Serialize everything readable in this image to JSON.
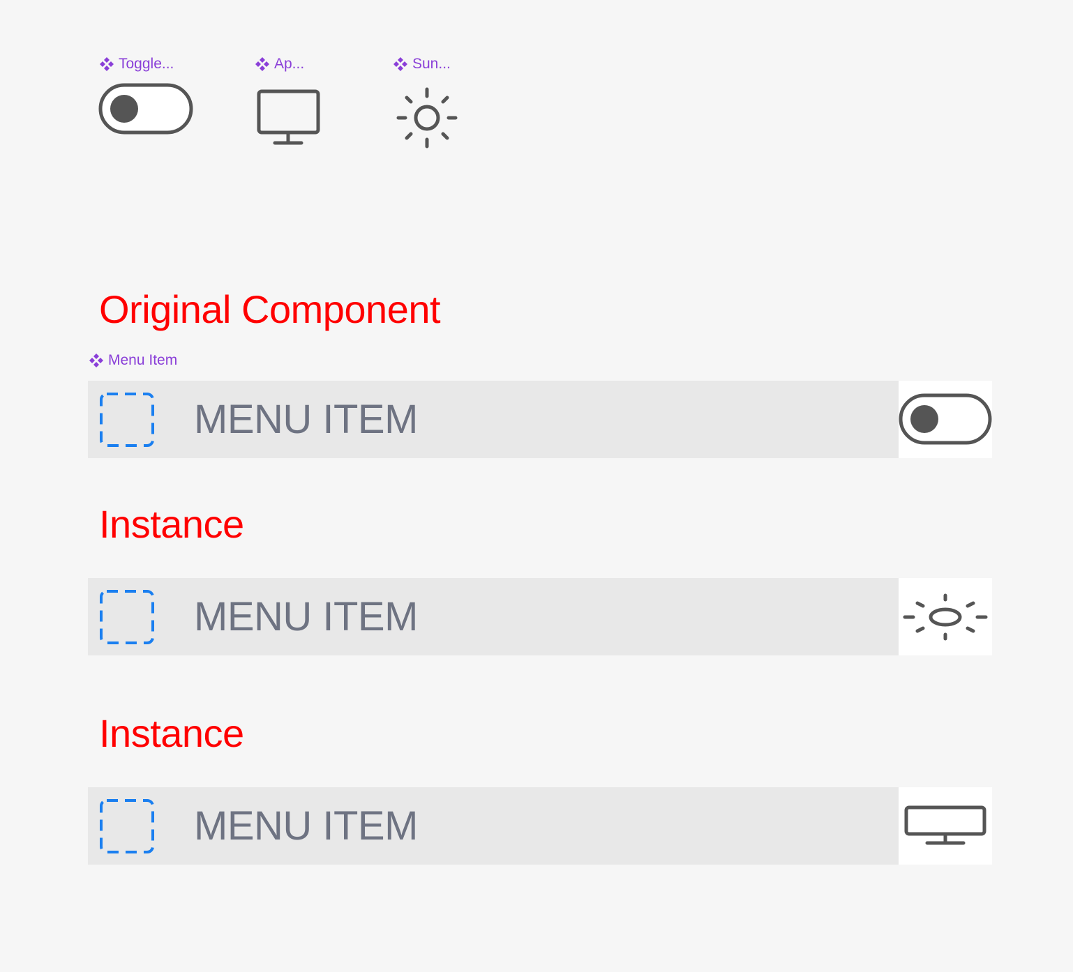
{
  "components": {
    "toggle_label": "Toggle...",
    "app_label": "Ap...",
    "sun_label": "Sun...",
    "menu_item_label": "Menu Item"
  },
  "sections": {
    "original_heading": "Original Component",
    "instance_heading_1": "Instance",
    "instance_heading_2": "Instance"
  },
  "menu_rows": [
    {
      "label": "MENU ITEM",
      "trailing_icon": "toggle-icon"
    },
    {
      "label": "MENU ITEM",
      "trailing_icon": "sun-icon"
    },
    {
      "label": "MENU ITEM",
      "trailing_icon": "monitor-icon"
    }
  ],
  "colors": {
    "canvas": "#f6f6f6",
    "component_label": "#8a3fd8",
    "heading": "#ff0000",
    "row_bg": "#e8e8e8",
    "row_text": "#6e7382",
    "placeholder": "#1a7ff0",
    "icon": "#555555"
  }
}
